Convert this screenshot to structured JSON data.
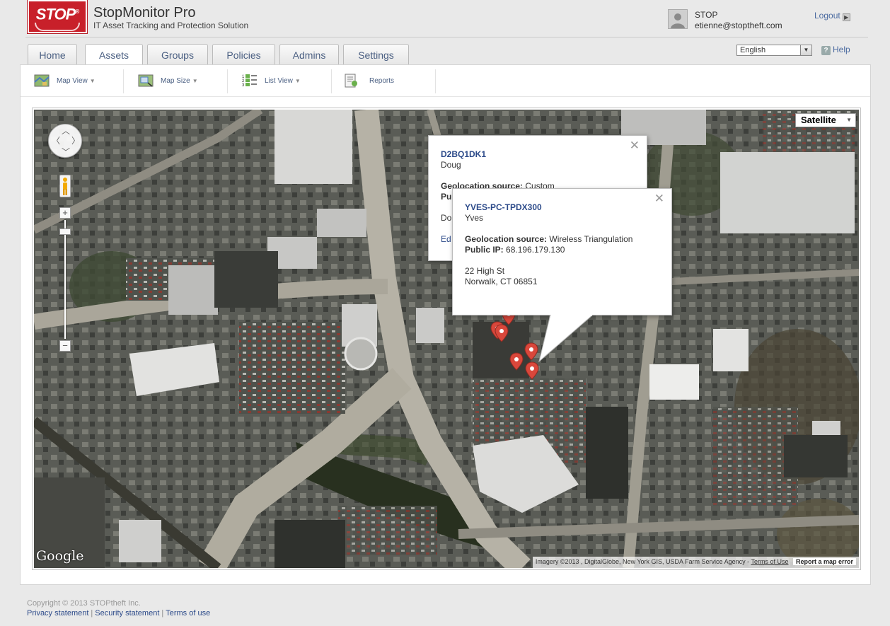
{
  "header": {
    "logo_text": "STOP",
    "logo_reg": "®",
    "app_title": "StopMonitor Pro",
    "app_subtitle": "IT Asset Tracking and Protection Solution",
    "user_name": "STOP",
    "user_email": "etienne@stoptheft.com",
    "logout_label": "Logout"
  },
  "tabs": [
    {
      "label": "Home",
      "active": false
    },
    {
      "label": "Assets",
      "active": true
    },
    {
      "label": "Groups",
      "active": false
    },
    {
      "label": "Policies",
      "active": false
    },
    {
      "label": "Admins",
      "active": false
    },
    {
      "label": "Settings",
      "active": false
    }
  ],
  "language": {
    "selected": "English"
  },
  "help_label": "Help",
  "toolbar": {
    "map_view": "Map View",
    "map_size": "Map Size",
    "list_view": "List View",
    "reports": "Reports"
  },
  "map": {
    "type_selected": "Satellite",
    "google_label": "Google",
    "attribution": "Imagery ©2013 , DigitalGlobe, New York GIS, USDA Farm Service Agency -",
    "terms_label": "Terms of Use",
    "report_label": "Report a map error",
    "zoom_in": "+",
    "zoom_out": "−"
  },
  "infowindow_back": {
    "device": "D2BQ1DK1",
    "user": "Doug",
    "geo_label": "Geolocation source:",
    "geo_value": "Custom",
    "ip_label_partial": "Pu",
    "address_partial": "Do",
    "edit_partial": "Ed"
  },
  "infowindow_front": {
    "device": "YVES-PC-TPDX300",
    "user": "Yves",
    "geo_label": "Geolocation source:",
    "geo_value": "Wireless Triangulation",
    "ip_label": "Public IP:",
    "ip_value": "68.196.179.130",
    "address_line1": "22 High St",
    "address_line2": "Norwalk, CT 06851"
  },
  "footer": {
    "copyright": "Copyright © 2013 STOPtheft Inc.",
    "privacy": "Privacy statement",
    "security": "Security statement",
    "terms": "Terms of use"
  },
  "colors": {
    "brand_red": "#c8202a",
    "link_blue": "#2d4b8a",
    "tab_text": "#4a5f82",
    "marker_red": "#d9473b"
  }
}
